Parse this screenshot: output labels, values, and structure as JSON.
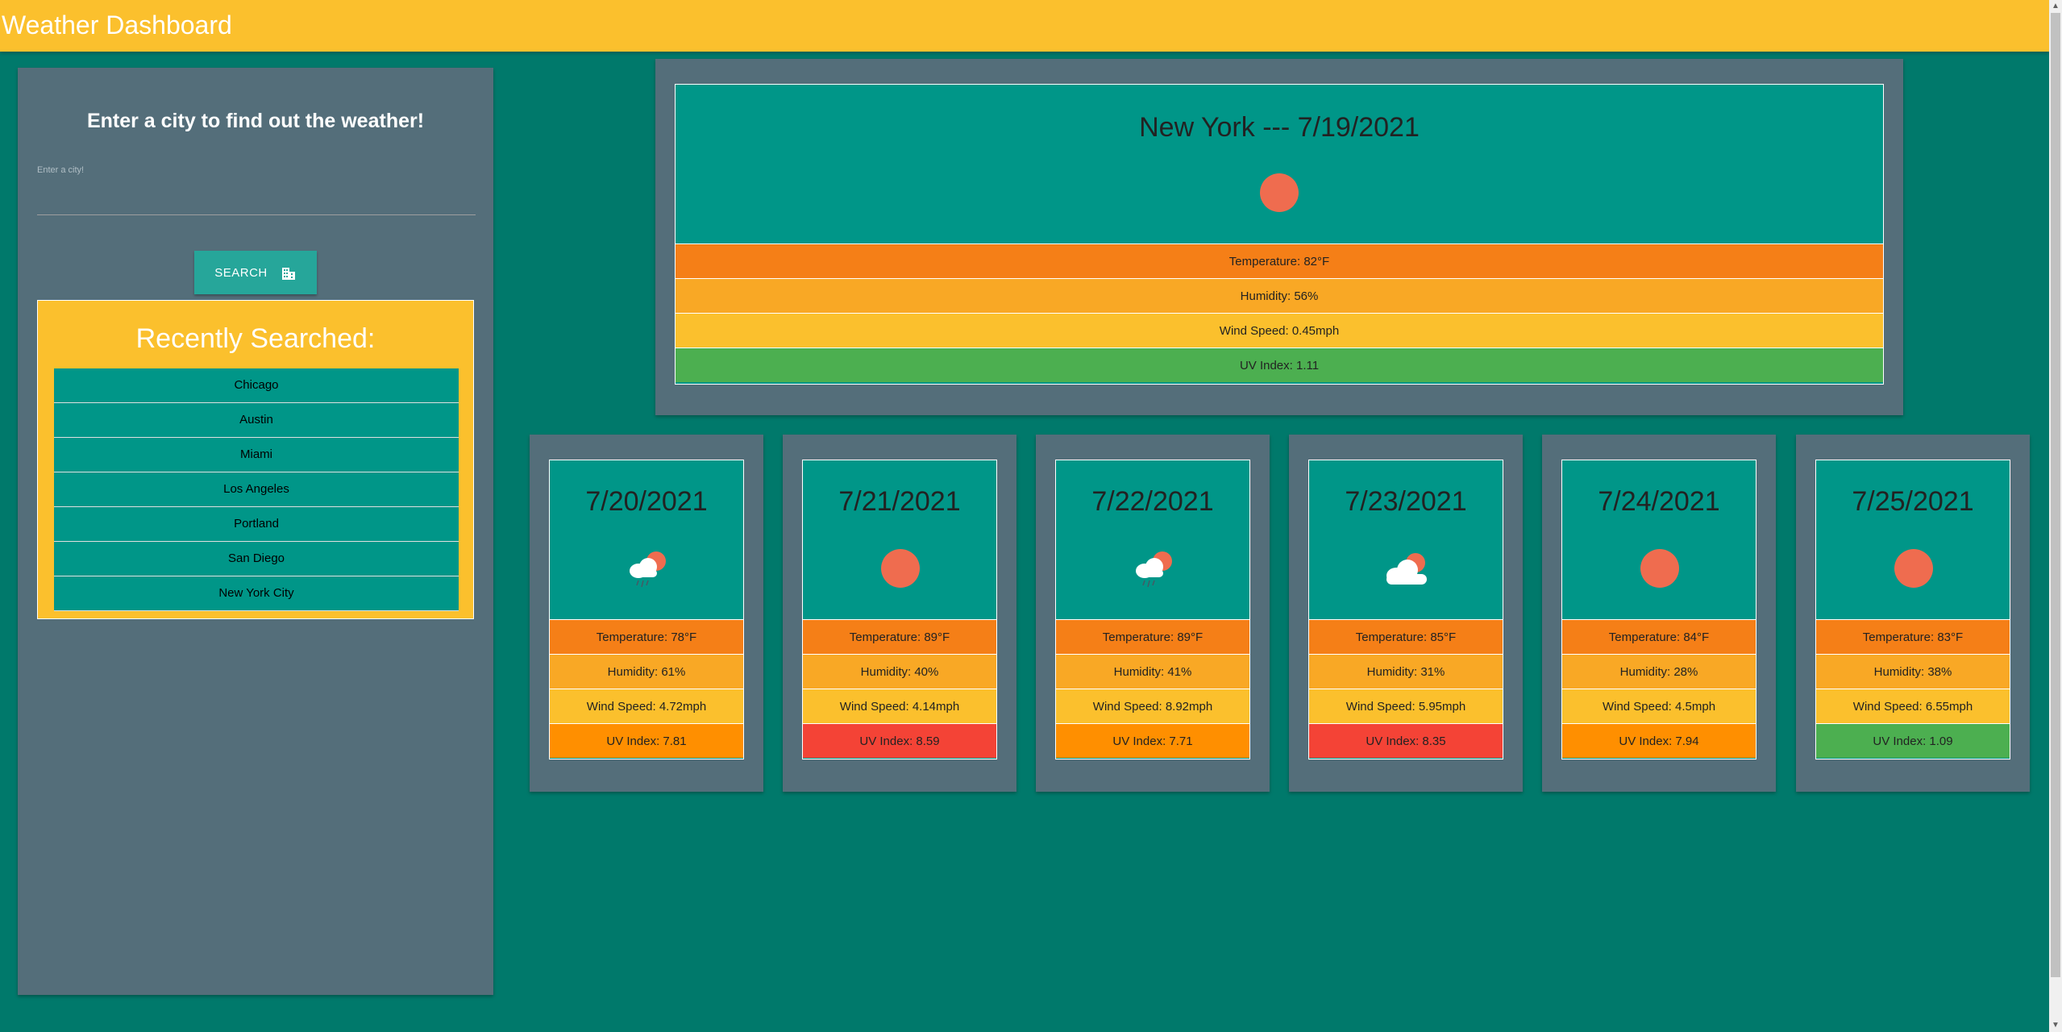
{
  "navbar": {
    "title": "Weather Dashboard"
  },
  "search": {
    "prompt": "Enter a city to find out the weather!",
    "input_label": "Enter a city!",
    "input_value": "",
    "button_label": "SEARCH",
    "button_icon": "building-icon"
  },
  "recent": {
    "title": "Recently Searched:",
    "items": [
      "Chicago",
      "Austin",
      "Miami",
      "Los Angeles",
      "Portland",
      "San Diego",
      "New York City"
    ]
  },
  "current": {
    "title": "New York --- 7/19/2021",
    "icon": "sun-icon",
    "temperature": "Temperature: 82°F",
    "humidity": "Humidity: 56%",
    "wind": "Wind Speed: 0.45mph",
    "uv": "UV Index: 1.11",
    "uv_level": "green"
  },
  "forecast": [
    {
      "date": "7/20/2021",
      "icon": "rain-cloud-sun-icon",
      "temperature": "Temperature: 78°F",
      "humidity": "Humidity: 61%",
      "wind": "Wind Speed: 4.72mph",
      "uv": "UV Index: 7.81",
      "uv_level": "orange"
    },
    {
      "date": "7/21/2021",
      "icon": "sun-icon",
      "temperature": "Temperature: 89°F",
      "humidity": "Humidity: 40%",
      "wind": "Wind Speed: 4.14mph",
      "uv": "UV Index: 8.59",
      "uv_level": "red"
    },
    {
      "date": "7/22/2021",
      "icon": "rain-cloud-sun-icon",
      "temperature": "Temperature: 89°F",
      "humidity": "Humidity: 41%",
      "wind": "Wind Speed: 8.92mph",
      "uv": "UV Index: 7.71",
      "uv_level": "orange"
    },
    {
      "date": "7/23/2021",
      "icon": "cloud-sun-icon",
      "temperature": "Temperature: 85°F",
      "humidity": "Humidity: 31%",
      "wind": "Wind Speed: 5.95mph",
      "uv": "UV Index: 8.35",
      "uv_level": "red"
    },
    {
      "date": "7/24/2021",
      "icon": "sun-icon",
      "temperature": "Temperature: 84°F",
      "humidity": "Humidity: 28%",
      "wind": "Wind Speed: 4.5mph",
      "uv": "UV Index: 7.94",
      "uv_level": "orange"
    },
    {
      "date": "7/25/2021",
      "icon": "sun-icon",
      "temperature": "Temperature: 83°F",
      "humidity": "Humidity: 38%",
      "wind": "Wind Speed: 6.55mph",
      "uv": "UV Index: 1.09",
      "uv_level": "green"
    }
  ],
  "colors": {
    "page_bg": "#00796b",
    "navbar": "#fbc02d",
    "panel": "#546e7a",
    "card": "#009688",
    "temperature_row": "#f57f17",
    "humidity_row": "#f9a825",
    "wind_row": "#fbc02d",
    "uv_low": "#4caf50",
    "uv_high": "#ff8f00",
    "uv_very_high": "#f44336",
    "sun": "#ef6c4f"
  }
}
